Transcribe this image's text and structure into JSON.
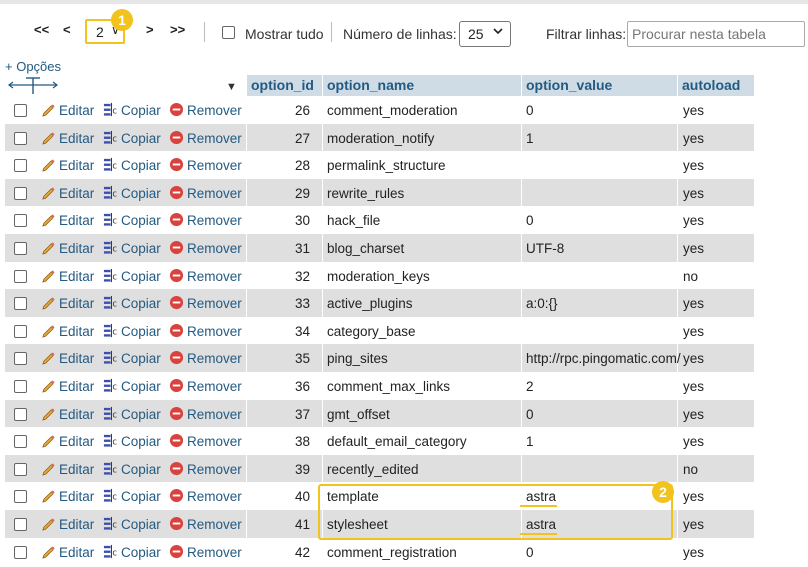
{
  "pager": {
    "first": "<<",
    "prev": "<",
    "page_value": "2",
    "next": ">",
    "last": ">>",
    "show_all_label": "Mostrar tudo",
    "rows_label": "Número de linhas:",
    "rows_value": "25",
    "filter_label": "Filtrar linhas:",
    "filter_placeholder": "Procurar nesta tabela"
  },
  "badges": [
    "1",
    "2"
  ],
  "options_link": "+ Opções",
  "columns": [
    "option_id",
    "option_name",
    "option_value",
    "autoload"
  ],
  "actions": {
    "edit": "Editar",
    "copy": "Copiar",
    "remove": "Remover"
  },
  "rows": [
    {
      "id": "26",
      "name": "comment_moderation",
      "value": "0",
      "autoload": "yes"
    },
    {
      "id": "27",
      "name": "moderation_notify",
      "value": "1",
      "autoload": "yes"
    },
    {
      "id": "28",
      "name": "permalink_structure",
      "value": "",
      "autoload": "yes"
    },
    {
      "id": "29",
      "name": "rewrite_rules",
      "value": "",
      "autoload": "yes"
    },
    {
      "id": "30",
      "name": "hack_file",
      "value": "0",
      "autoload": "yes"
    },
    {
      "id": "31",
      "name": "blog_charset",
      "value": "UTF-8",
      "autoload": "yes"
    },
    {
      "id": "32",
      "name": "moderation_keys",
      "value": "",
      "autoload": "no"
    },
    {
      "id": "33",
      "name": "active_plugins",
      "value": "a:0:{}",
      "autoload": "yes"
    },
    {
      "id": "34",
      "name": "category_base",
      "value": "",
      "autoload": "yes"
    },
    {
      "id": "35",
      "name": "ping_sites",
      "value": "http://rpc.pingomatic.com/",
      "autoload": "yes"
    },
    {
      "id": "36",
      "name": "comment_max_links",
      "value": "2",
      "autoload": "yes"
    },
    {
      "id": "37",
      "name": "gmt_offset",
      "value": "0",
      "autoload": "yes"
    },
    {
      "id": "38",
      "name": "default_email_category",
      "value": "1",
      "autoload": "yes"
    },
    {
      "id": "39",
      "name": "recently_edited",
      "value": "",
      "autoload": "no"
    },
    {
      "id": "40",
      "name": "template",
      "value": "astra",
      "autoload": "yes"
    },
    {
      "id": "41",
      "name": "stylesheet",
      "value": "astra",
      "autoload": "yes"
    },
    {
      "id": "42",
      "name": "comment_registration",
      "value": "0",
      "autoload": "yes"
    }
  ],
  "colors": {
    "highlight": "#f2c21d",
    "link": "#235a81",
    "header_bg": "#cfdce6",
    "row_alt": "#dfdfdf"
  }
}
